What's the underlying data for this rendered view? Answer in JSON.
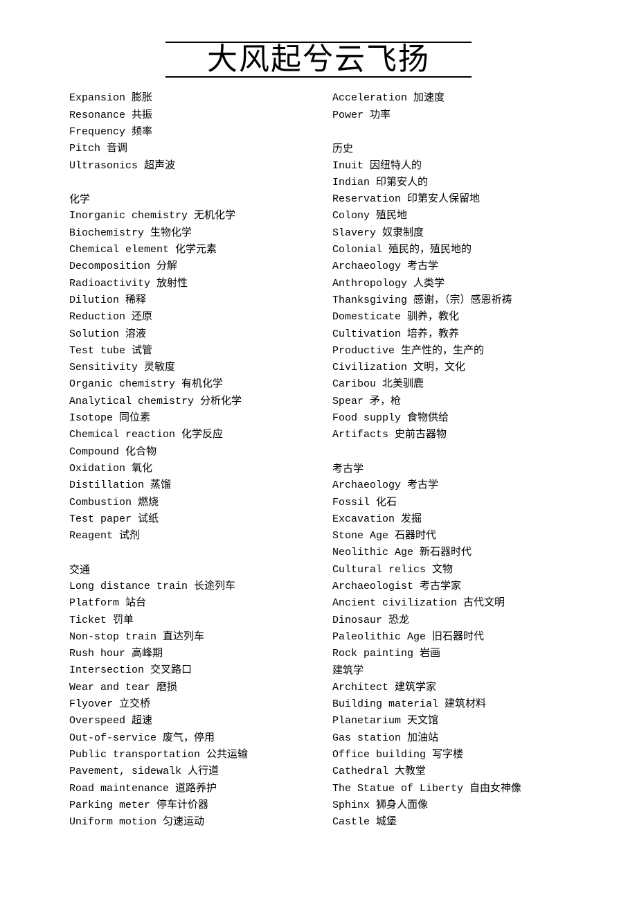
{
  "title": "大风起兮云飞扬",
  "left": [
    {
      "type": "entry",
      "text": "Expansion 膨胀"
    },
    {
      "type": "entry",
      "text": "Resonance 共振"
    },
    {
      "type": "entry",
      "text": "Frequency 频率"
    },
    {
      "type": "entry",
      "text": "Pitch 音调"
    },
    {
      "type": "entry",
      "text": "Ultrasonics 超声波"
    },
    {
      "type": "blank"
    },
    {
      "type": "heading",
      "text": "化学"
    },
    {
      "type": "entry",
      "text": "Inorganic chemistry 无机化学"
    },
    {
      "type": "entry",
      "text": "Biochemistry 生物化学"
    },
    {
      "type": "entry",
      "text": "Chemical element 化学元素"
    },
    {
      "type": "entry",
      "text": "Decomposition 分解"
    },
    {
      "type": "entry",
      "text": "Radioactivity 放射性"
    },
    {
      "type": "entry",
      "text": "Dilution 稀释"
    },
    {
      "type": "entry",
      "text": "Reduction 还原"
    },
    {
      "type": "entry",
      "text": "Solution 溶液"
    },
    {
      "type": "entry",
      "text": "Test tube 试管"
    },
    {
      "type": "entry",
      "text": "Sensitivity 灵敏度"
    },
    {
      "type": "entry",
      "text": "Organic chemistry 有机化学"
    },
    {
      "type": "entry",
      "text": "Analytical chemistry 分析化学"
    },
    {
      "type": "entry",
      "text": "Isotope 同位素"
    },
    {
      "type": "entry",
      "text": "Chemical reaction 化学反应"
    },
    {
      "type": "entry",
      "text": "Compound 化合物"
    },
    {
      "type": "entry",
      "text": "Oxidation 氧化"
    },
    {
      "type": "entry",
      "text": "Distillation 蒸馏"
    },
    {
      "type": "entry",
      "text": "Combustion 燃烧"
    },
    {
      "type": "entry",
      "text": "Test paper 试纸"
    },
    {
      "type": "entry",
      "text": "Reagent 试剂"
    },
    {
      "type": "blank"
    },
    {
      "type": "heading",
      "text": "交通"
    },
    {
      "type": "entry",
      "text": "Long distance train 长途列车"
    },
    {
      "type": "entry",
      "text": "Platform 站台"
    },
    {
      "type": "entry",
      "text": "Ticket 罚单"
    },
    {
      "type": "entry",
      "text": "Non-stop train 直达列车"
    },
    {
      "type": "entry",
      "text": "Rush hour 高峰期"
    },
    {
      "type": "entry",
      "text": "Intersection 交叉路口"
    },
    {
      "type": "entry",
      "text": "Wear and tear 磨损"
    },
    {
      "type": "entry",
      "text": "Flyover 立交桥"
    },
    {
      "type": "entry",
      "text": "Overspeed 超速"
    },
    {
      "type": "entry",
      "text": "Out-of-service 废气，停用"
    },
    {
      "type": "entry",
      "text": "Public transportation 公共运输"
    },
    {
      "type": "entry",
      "text": "Pavement, sidewalk 人行道"
    },
    {
      "type": "entry",
      "text": "Road maintenance 道路养护"
    },
    {
      "type": "entry",
      "text": "Parking meter 停车计价器"
    },
    {
      "type": "entry",
      "text": "Uniform motion 匀速运动"
    }
  ],
  "right": [
    {
      "type": "entry",
      "text": "Acceleration 加速度"
    },
    {
      "type": "entry",
      "text": "Power 功率"
    },
    {
      "type": "blank"
    },
    {
      "type": "heading",
      "text": "历史"
    },
    {
      "type": "entry",
      "text": "Inuit 因纽特人的"
    },
    {
      "type": "entry",
      "text": "Indian 印第安人的"
    },
    {
      "type": "entry",
      "text": "Reservation 印第安人保留地"
    },
    {
      "type": "entry",
      "text": "Colony 殖民地"
    },
    {
      "type": "entry",
      "text": "Slavery 奴隶制度"
    },
    {
      "type": "entry",
      "text": "Colonial 殖民的，殖民地的"
    },
    {
      "type": "entry",
      "text": "Archaeology 考古学"
    },
    {
      "type": "entry",
      "text": "Anthropology 人类学"
    },
    {
      "type": "entry",
      "text": "Thanksgiving 感谢，（宗）感恩祈祷"
    },
    {
      "type": "entry",
      "text": "Domesticate 驯养，教化"
    },
    {
      "type": "entry",
      "text": "Cultivation 培养，教养"
    },
    {
      "type": "entry",
      "text": "Productive 生产性的，生产的"
    },
    {
      "type": "entry",
      "text": "Civilization 文明，文化"
    },
    {
      "type": "entry",
      "text": "Caribou 北美驯鹿"
    },
    {
      "type": "entry",
      "text": "Spear 矛，枪"
    },
    {
      "type": "entry",
      "text": "Food supply 食物供给"
    },
    {
      "type": "entry",
      "text": "Artifacts 史前古器物"
    },
    {
      "type": "blank"
    },
    {
      "type": "heading",
      "text": "考古学"
    },
    {
      "type": "entry",
      "text": "Archaeology 考古学"
    },
    {
      "type": "entry",
      "text": "Fossil 化石"
    },
    {
      "type": "entry",
      "text": "Excavation 发掘"
    },
    {
      "type": "entry",
      "text": "Stone Age 石器时代"
    },
    {
      "type": "entry",
      "text": "Neolithic Age 新石器时代"
    },
    {
      "type": "entry",
      "text": "Cultural relics 文物"
    },
    {
      "type": "entry",
      "text": "Archaeologist 考古学家"
    },
    {
      "type": "entry",
      "text": "Ancient civilization 古代文明"
    },
    {
      "type": "entry",
      "text": "Dinosaur 恐龙"
    },
    {
      "type": "entry",
      "text": "Paleolithic Age 旧石器时代"
    },
    {
      "type": "entry",
      "text": "Rock painting 岩画"
    },
    {
      "type": "heading",
      "text": "建筑学"
    },
    {
      "type": "entry",
      "text": "Architect 建筑学家"
    },
    {
      "type": "entry",
      "text": "Building material 建筑材料"
    },
    {
      "type": "entry",
      "text": "Planetarium 天文馆"
    },
    {
      "type": "entry",
      "text": "Gas station 加油站"
    },
    {
      "type": "entry",
      "text": "Office building 写字楼"
    },
    {
      "type": "entry",
      "text": "Cathedral 大教堂"
    },
    {
      "type": "entry",
      "text": "The Statue of Liberty 自由女神像"
    },
    {
      "type": "entry",
      "text": "Sphinx 狮身人面像"
    },
    {
      "type": "entry",
      "text": "Castle 城堡"
    }
  ]
}
